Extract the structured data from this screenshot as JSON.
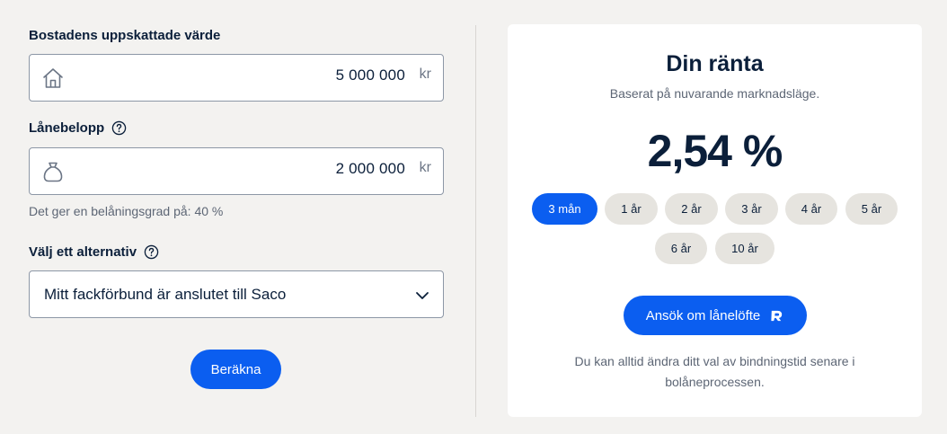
{
  "form": {
    "property_value": {
      "label": "Bostadens uppskattade värde",
      "value": "5 000 000",
      "unit": "kr",
      "icon": "house-icon"
    },
    "loan_amount": {
      "label": "Lånebelopp",
      "value": "2 000 000",
      "unit": "kr",
      "icon": "money-bag-icon",
      "help_icon": "help-icon"
    },
    "ltv_text": "Det ger en belåningsgrad på: 40 %",
    "option": {
      "label": "Välj ett alternativ",
      "selected": "Mitt fackförbund är anslutet till Saco",
      "help_icon": "help-icon"
    },
    "calculate_label": "Beräkna"
  },
  "result": {
    "title": "Din ränta",
    "subtitle": "Baserat på nuvarande marknadsläge.",
    "rate": "2,54 %",
    "terms": [
      "3 mån",
      "1 år",
      "2 år",
      "3 år",
      "4 år",
      "5 år",
      "6 år",
      "10 år"
    ],
    "selected_term": "3 mån",
    "apply_label": "Ansök om lånelöfte",
    "apply_icon": "bank-logo-icon",
    "footnote": "Du kan alltid ändra ditt val av bindningstid senare i bolåneprocessen."
  },
  "colors": {
    "accent": "#0b5ef0",
    "text": "#0b1f3a",
    "muted": "#5d6675",
    "background": "#f3f2f0",
    "pill": "#e6e4df"
  }
}
